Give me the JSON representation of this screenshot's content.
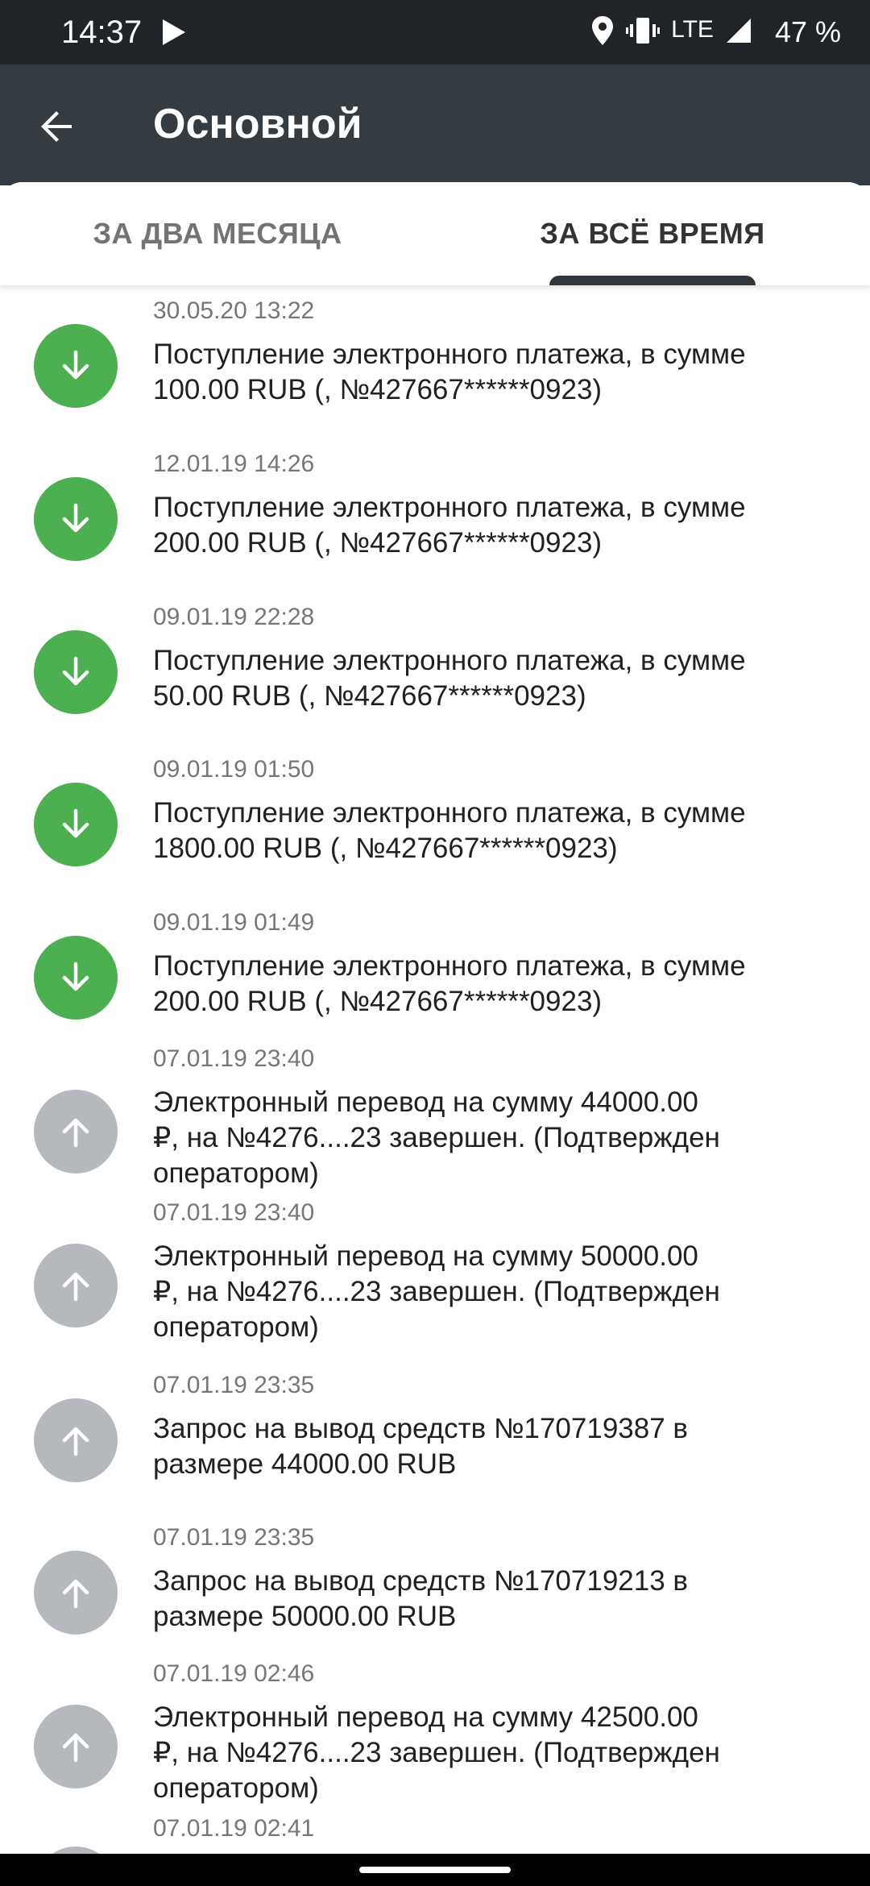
{
  "status_bar": {
    "time": "14:37",
    "network": "LTE",
    "battery": "47 %",
    "icons": [
      "play-icon",
      "location-icon",
      "vibrate-icon",
      "signal-icon"
    ]
  },
  "app_bar": {
    "title": "Основной",
    "back_icon": "arrow-back-icon"
  },
  "tabs": [
    {
      "label": "ЗА ДВА МЕСЯЦА",
      "selected": false
    },
    {
      "label": "ЗА ВСЁ ВРЕМЯ",
      "selected": true
    }
  ],
  "transactions": [
    {
      "date": "30.05.20 13:22",
      "text": "Поступление электронного платежа, в сумме\n100.00 RUB (,  №427667******0923)",
      "direction": "in"
    },
    {
      "date": "12.01.19 14:26",
      "text": "Поступление электронного платежа, в сумме\n200.00 RUB (,  №427667******0923)",
      "direction": "in"
    },
    {
      "date": "09.01.19 22:28",
      "text": "Поступление электронного платежа, в сумме\n50.00 RUB (,  №427667******0923)",
      "direction": "in"
    },
    {
      "date": "09.01.19 01:50",
      "text": "Поступление электронного платежа, в сумме\n1800.00 RUB (,  №427667******0923)",
      "direction": "in"
    },
    {
      "date": "09.01.19 01:49",
      "text": "Поступление электронного платежа, в сумме\n200.00 RUB (,  №427667******0923)",
      "direction": "in"
    },
    {
      "date": "07.01.19 23:40",
      "text": "Электронный перевод на сумму 44000.00\n₽, на №4276....23 завершен. (Подтвержден\nоператором)",
      "direction": "out"
    },
    {
      "date": "07.01.19 23:40",
      "text": "Электронный перевод на сумму 50000.00\n₽, на №4276....23 завершен. (Подтвержден\nоператором)",
      "direction": "out"
    },
    {
      "date": "07.01.19 23:35",
      "text": "Запрос на вывод средств №170719387 в\nразмере 44000.00 RUB",
      "direction": "out"
    },
    {
      "date": "07.01.19 23:35",
      "text": "Запрос на вывод средств №170719213 в\nразмере 50000.00 RUB",
      "direction": "out"
    },
    {
      "date": "07.01.19 02:46",
      "text": "Электронный перевод на сумму 42500.00\n₽, на №4276....23 завершен. (Подтвержден\nоператором)",
      "direction": "out"
    },
    {
      "date": "07.01.19 02:41",
      "text": "",
      "direction": "out"
    }
  ],
  "colors": {
    "status_bar": "#202428",
    "app_bar": "#353c41",
    "incoming": "#4caf50",
    "outgoing": "#b5b9bd",
    "tab_indicator": "#30373c"
  }
}
